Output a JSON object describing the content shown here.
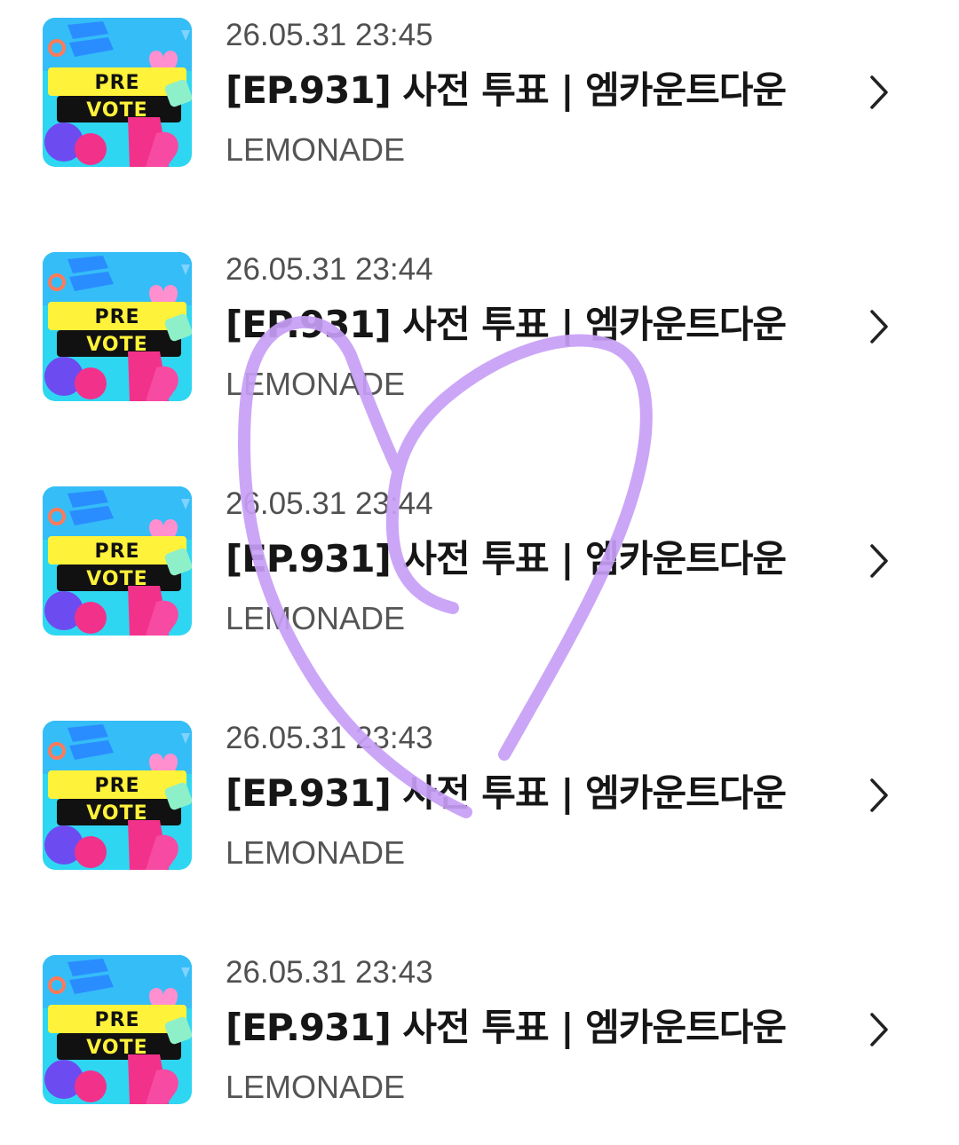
{
  "items": [
    {
      "date": "26.05.31 23:45",
      "title": "[EP.931] 사전 투표 | 엠카운트다운",
      "artist": "LEMONADE",
      "thumb_line1": "PRE",
      "thumb_line2": "VOTE"
    },
    {
      "date": "26.05.31 23:44",
      "title": "[EP.931] 사전 투표 | 엠카운트다운",
      "artist": "LEMONADE",
      "thumb_line1": "PRE",
      "thumb_line2": "VOTE"
    },
    {
      "date": "26.05.31 23:44",
      "title": "[EP.931] 사전 투표 | 엠카운트다운",
      "artist": "LEMONADE",
      "thumb_line1": "PRE",
      "thumb_line2": "VOTE"
    },
    {
      "date": "26.05.31 23:43",
      "title": "[EP.931] 사전 투표 | 엠카운트다운",
      "artist": "LEMONADE",
      "thumb_line1": "PRE",
      "thumb_line2": "VOTE"
    },
    {
      "date": "26.05.31 23:43",
      "title": "[EP.931] 사전 투표 | 엠카운트다운",
      "artist": "LEMONADE",
      "thumb_line1": "PRE",
      "thumb_line2": "VOTE"
    }
  ],
  "icons": {
    "row_arrow": "chevron-right-icon",
    "overlay": "heart-doodle"
  },
  "colors": {
    "heart_stroke": "#c79ef6",
    "thumb_bg": "#2fd6f2",
    "thumb_banner": "#fff23a",
    "thumb_banner_dark": "#111111",
    "thumb_heart": "#ff8fcf",
    "thumb_magenta": "#f2318a",
    "thumb_purple": "#6c4cf0"
  }
}
